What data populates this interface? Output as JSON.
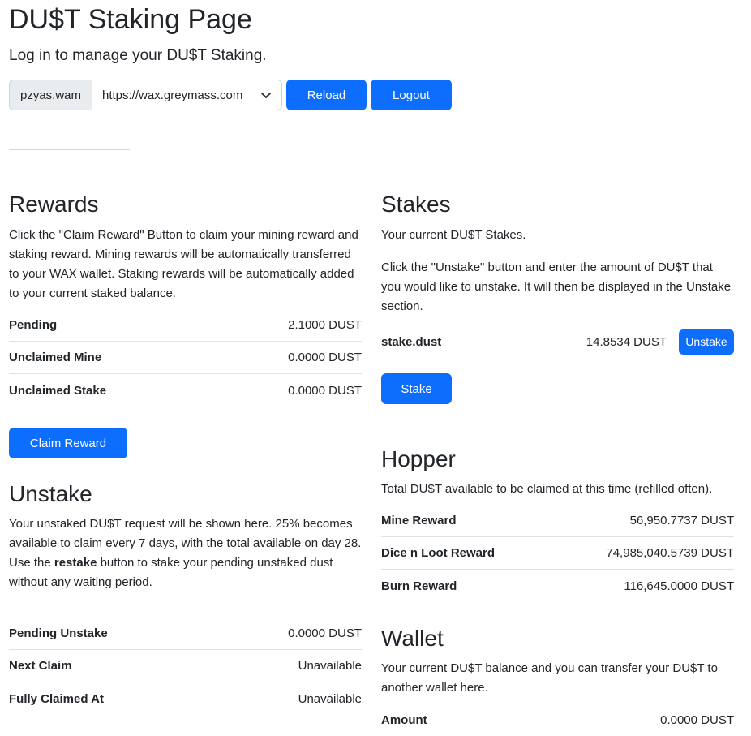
{
  "header": {
    "title": "DU$T Staking Page",
    "subtitle": "Log in to manage your DU$T Staking."
  },
  "login": {
    "account": "pzyas.wam",
    "endpoint": "https://wax.greymass.com",
    "reload_label": "Reload",
    "logout_label": "Logout"
  },
  "rewards": {
    "title": "Rewards",
    "description": "Click the \"Claim Reward\" Button to claim your mining reward and staking reward. Mining rewards will be automatically transferred to your WAX wallet. Staking rewards will be automatically added to your current staked balance.",
    "rows": [
      {
        "label": "Pending",
        "value": "2.1000 DUST"
      },
      {
        "label": "Unclaimed Mine",
        "value": "0.0000 DUST"
      },
      {
        "label": "Unclaimed Stake",
        "value": "0.0000 DUST"
      }
    ],
    "claim_label": "Claim Reward"
  },
  "unstake": {
    "title": "Unstake",
    "description": "Your unstaked DU$T request will be shown here. 25% becomes available to claim every 7 days, with the total available on day 28.",
    "restake_prefix": "Use the ",
    "restake_bold": "restake",
    "restake_suffix": " button to stake your pending unstaked dust without any waiting period.",
    "rows": [
      {
        "label": "Pending Unstake",
        "value": "0.0000 DUST"
      },
      {
        "label": "Next Claim",
        "value": "Unavailable"
      },
      {
        "label": "Fully Claimed At",
        "value": "Unavailable"
      }
    ]
  },
  "stakes": {
    "title": "Stakes",
    "intro": "Your current DU$T Stakes.",
    "description": "Click the \"Unstake\" button and enter the amount of DU$T that you would like to unstake. It will then be displayed in the Unstake section.",
    "stake_row": {
      "label": "stake.dust",
      "value": "14.8534 DUST",
      "unstake_label": "Unstake"
    },
    "stake_label": "Stake"
  },
  "hopper": {
    "title": "Hopper",
    "description": "Total DU$T available to be claimed at this time (refilled often).",
    "rows": [
      {
        "label": "Mine Reward",
        "value": "56,950.7737 DUST"
      },
      {
        "label": "Dice n Loot Reward",
        "value": "74,985,040.5739 DUST"
      },
      {
        "label": "Burn Reward",
        "value": "116,645.0000 DUST"
      }
    ]
  },
  "wallet": {
    "title": "Wallet",
    "description": "Your current DU$T balance and you can transfer your DU$T to another wallet here.",
    "rows": [
      {
        "label": "Amount",
        "value": "0.0000 DUST"
      }
    ]
  },
  "colors": {
    "primary": "#0d6efd",
    "text": "#212529",
    "border": "#dee2e6",
    "input_group_bg": "#e9ecef"
  }
}
